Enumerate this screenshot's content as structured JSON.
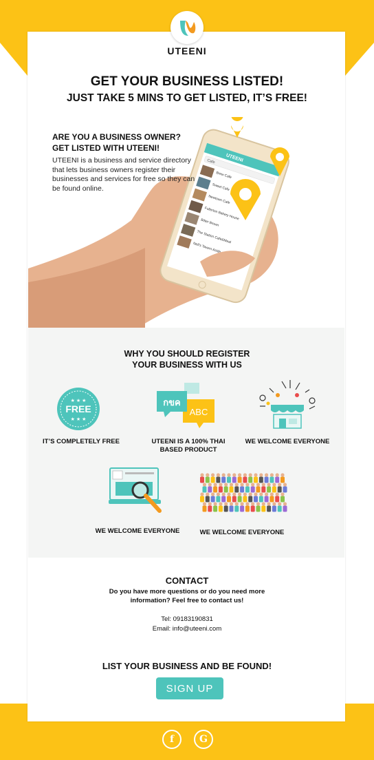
{
  "brand": {
    "name": "UTEENI",
    "colors": {
      "yellow": "#fcc216",
      "teal": "#4ec4bb",
      "orange": "#f39a1f"
    }
  },
  "hero": {
    "title": "GET YOUR BUSINESS LISTED!",
    "subtitle": "JUST TAKE 5 MINS TO GET LISTED, IT’S FREE!",
    "owner_line1": "ARE YOU A BUSINESS OWNER?",
    "owner_line2": "GET LISTED WITH UTEENI!",
    "description": "UTEENI is a business and service directory that lets business owners register their businesses and services for free so they can be found online.",
    "phone_header": "UTEENI",
    "phone_search": "Cafe",
    "phone_items": [
      "Brew Cafe",
      "Sweet Cafe",
      "Newtown Cafe",
      "Fullerton Bakery House",
      "Bitter Brown",
      "The Station Cafe&Meal",
      "Nell's Tavern Aside"
    ]
  },
  "why": {
    "title_line1": "WHY YOU SHOULD REGISTER",
    "title_line2": "YOUR BUSINESS WITH US",
    "free_badge": "FREE",
    "thai_bubble": "กขค",
    "abc_bubble": "ABC",
    "features": [
      {
        "label": "IT’S COMPLETELY FREE",
        "icon": "free-badge-icon"
      },
      {
        "label_line1": "UTEENI IS A 100% THAI",
        "label_line2": "BASED PRODUCT",
        "icon": "thai-language-bubbles-icon"
      },
      {
        "label": "WE WELCOME EVERYONE",
        "icon": "shop-with-services-icon"
      },
      {
        "label": "WE WELCOME EVERYONE",
        "icon": "laptop-search-icon"
      },
      {
        "label": "WE WELCOME EVERYONE",
        "icon": "crowd-of-people-icon"
      }
    ]
  },
  "contact": {
    "title": "CONTACT",
    "question_line1": "Do you have more questions or do you need more",
    "question_line2": "information? Feel free to contact us!",
    "tel": "Tel: 09183190831",
    "email": "Email: info@uteeni.com"
  },
  "cta": {
    "headline": "LIST YOUR BUSINESS AND BE FOUND!",
    "button": "SIGN UP"
  },
  "footer": {
    "social": [
      {
        "glyph": "f",
        "icon": "facebook-icon"
      },
      {
        "glyph": "G",
        "icon": "google-icon"
      }
    ]
  }
}
